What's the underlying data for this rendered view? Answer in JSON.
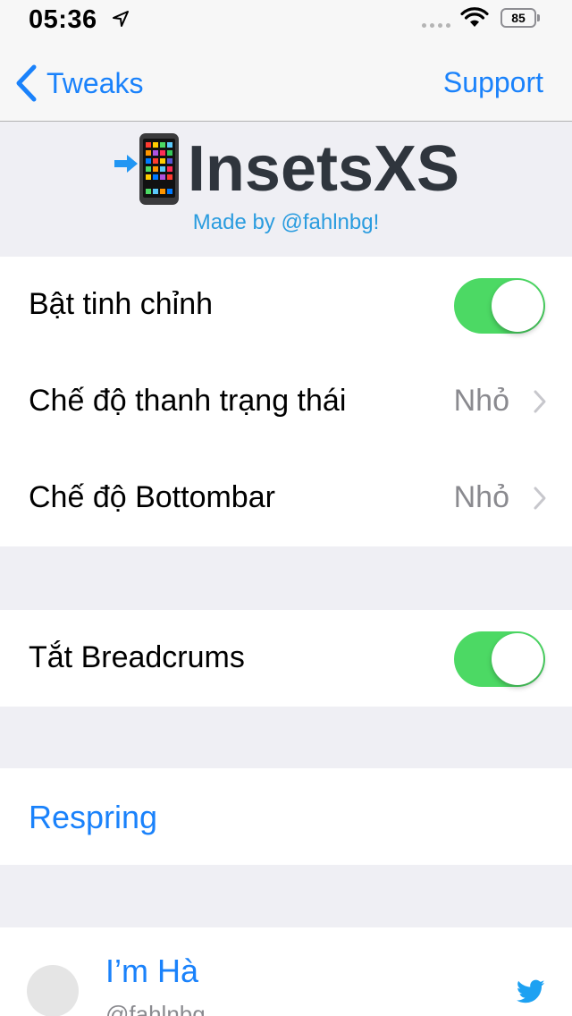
{
  "status_bar": {
    "time": "05:36",
    "battery": "85",
    "icons": [
      "location-arrow-icon",
      "signal-dots-icon",
      "wifi-icon",
      "battery-icon"
    ]
  },
  "nav": {
    "back_label": "Tweaks",
    "right_label": "Support"
  },
  "header": {
    "title": "InsetsXS",
    "subtitle": "Made by @fahlnbg!",
    "icon": "mobile-phone-arrow-icon"
  },
  "settings": {
    "enable_tweak": {
      "label": "Bật tinh chỉnh",
      "on": true
    },
    "statusbar_mode": {
      "label": "Chế độ thanh trạng thái",
      "value": "Nhỏ"
    },
    "bottombar_mode": {
      "label": "Chế độ Bottombar",
      "value": "Nhỏ"
    },
    "disable_breadcrumbs": {
      "label": "Tắt Breadcrums",
      "on": true
    },
    "respring": {
      "label": "Respring"
    }
  },
  "profile": {
    "name": "I’m Hà",
    "handle": "@fahlnbg",
    "icon": "twitter-bird-icon"
  },
  "colors": {
    "accent": "#1a82fb",
    "toggle_on": "#4cd964",
    "background": "#efeff4",
    "subtitle": "#2a9cdf"
  }
}
